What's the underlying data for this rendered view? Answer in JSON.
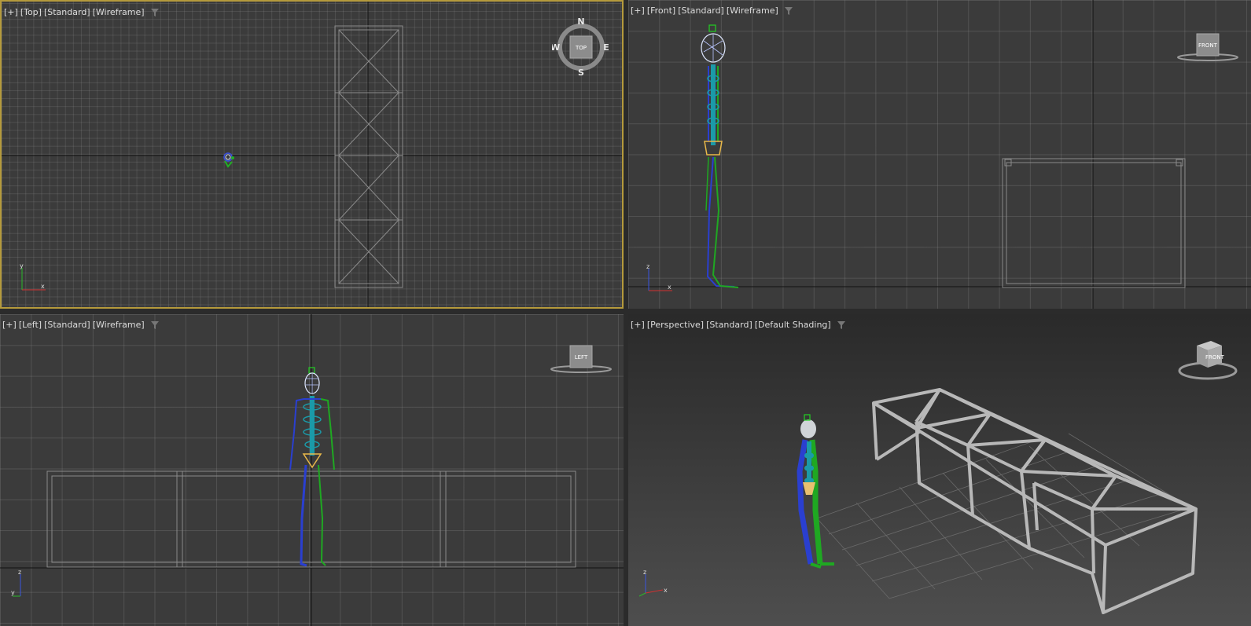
{
  "viewports": {
    "top": {
      "labels": [
        "[+]",
        "[Top]",
        "[Standard]",
        "[Wireframe]"
      ],
      "viewcube_face": "TOP",
      "compass": {
        "n": "N",
        "s": "S",
        "e": "E",
        "w": "W"
      },
      "axis": {
        "x": "x",
        "y": "y"
      },
      "active": true
    },
    "front": {
      "labels": [
        "[+]",
        "[Front]",
        "[Standard]",
        "[Wireframe]"
      ],
      "viewcube_face": "FRONT",
      "axis": {
        "x": "x",
        "y": "z"
      }
    },
    "left": {
      "labels": [
        "[+]",
        "[Left]",
        "[Standard]",
        "[Wireframe]"
      ],
      "viewcube_face": "LEFT",
      "axis": {
        "x": "y",
        "y": "z"
      }
    },
    "perspective": {
      "labels": [
        "[+]",
        "[Perspective]",
        "[Standard]",
        "[Default Shading]"
      ],
      "viewcube_face": "FRONT",
      "axis": {
        "x": "x",
        "y": "z"
      }
    }
  },
  "icons": {
    "filter": "filter-funnel-icon"
  },
  "colors": {
    "active_border": "#b59a3c",
    "viewport_bg": "#3b3b3b",
    "grid": "#5a5a5a",
    "biped_blue": "#2a3fd0",
    "biped_green": "#1fa822",
    "biped_cyan": "#1b9aa8",
    "truss": "#b8b8b8"
  }
}
